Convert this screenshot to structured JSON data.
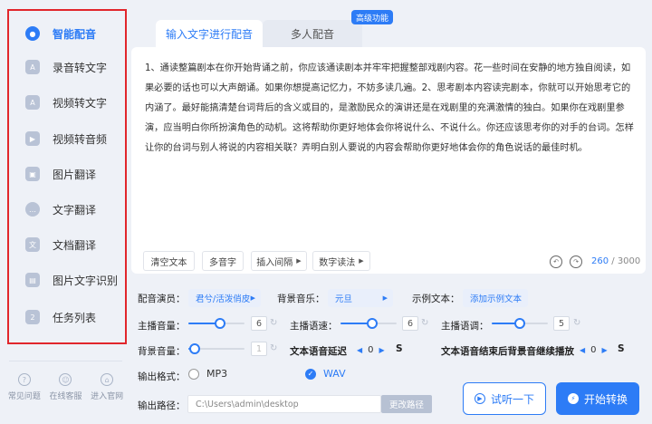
{
  "sidebar": {
    "items": [
      {
        "label": "智能配音",
        "icon": "microphone-icon"
      },
      {
        "label": "录音转文字",
        "icon": "audio-text-icon"
      },
      {
        "label": "视频转文字",
        "icon": "video-text-icon"
      },
      {
        "label": "视频转音频",
        "icon": "video-audio-icon"
      },
      {
        "label": "图片翻译",
        "icon": "image-translate-icon"
      },
      {
        "label": "文字翻译",
        "icon": "text-translate-icon"
      },
      {
        "label": "文档翻译",
        "icon": "document-translate-icon"
      },
      {
        "label": "图片文字识别",
        "icon": "ocr-icon"
      },
      {
        "label": "任务列表",
        "icon": "task-list-icon"
      }
    ],
    "active_index": 0,
    "bottom_links": [
      {
        "label": "常见问题",
        "icon": "question-icon"
      },
      {
        "label": "在线客服",
        "icon": "support-icon"
      },
      {
        "label": "进入官网",
        "icon": "website-icon"
      }
    ]
  },
  "tabs": {
    "active": "输入文字进行配音",
    "inactive": "多人配音",
    "badge": "高级功能"
  },
  "editor": {
    "text": "1、通读整篇剧本在你开始背诵之前，你应该通读剧本并牢牢把握整部戏剧内容。花一些时间在安静的地方独自阅读，如果必要的话也可以大声朗诵。如果你想提高记忆力，不妨多读几遍。2、思考剧本内容读完剧本，你就可以开始思考它的内涵了。最好能搞清楚台词背后的含义或目的，是激励民众的演讲还是在戏剧里的充满激情的独白。如果你在戏剧里参演，应当明白你所扮演角色的动机。这将帮助你更好地体会你将说什么、不说什么。你还应该思考你的对手的台词。怎样让你的台词与别人将说的内容相关联？弄明白别人要说的内容会帮助你更好地体会你的角色说话的最佳时机。",
    "tools": {
      "clear": "清空文本",
      "polyphone": "多音字",
      "insert_pause": "插入间隔",
      "number_reading": "数字读法"
    },
    "char_count": "260",
    "char_limit": " / 3000"
  },
  "settings": {
    "voice_label": "配音演员：",
    "voice_value": "君兮/活泼俏皮",
    "music_label": "背景音乐：",
    "music_value": "元旦",
    "sample_label": "示例文本：",
    "sample_value": "添加示例文本",
    "volume_label": "主播音量：",
    "volume_value": "6",
    "volume_level": 0.56,
    "speed_label": "主播语速：",
    "speed_value": "6",
    "speed_level": 0.56,
    "pitch_label": "主播语调：",
    "pitch_value": "5",
    "pitch_level": 0.5,
    "bg_volume_label": "背景音量：",
    "bg_volume_value": "1",
    "bg_volume_level": 0.12,
    "delay_label": "文本语音延迟",
    "delay_value": "0",
    "delay_unit": "S",
    "continue_label": "文本语音结束后背景音继续播放",
    "continue_value": "0",
    "continue_unit": "S",
    "format_label": "输出格式：",
    "format_mp3": "MP3",
    "format_wav": "WAV",
    "format_selected": "WAV",
    "path_label": "输出路径：",
    "path_value": "C:\\Users\\admin\\desktop",
    "change_path": "更改路径"
  },
  "actions": {
    "listen": "试听一下",
    "start": "开始转换"
  },
  "colors": {
    "accent": "#2d7cf6",
    "highlight_frame": "#e1262c"
  }
}
